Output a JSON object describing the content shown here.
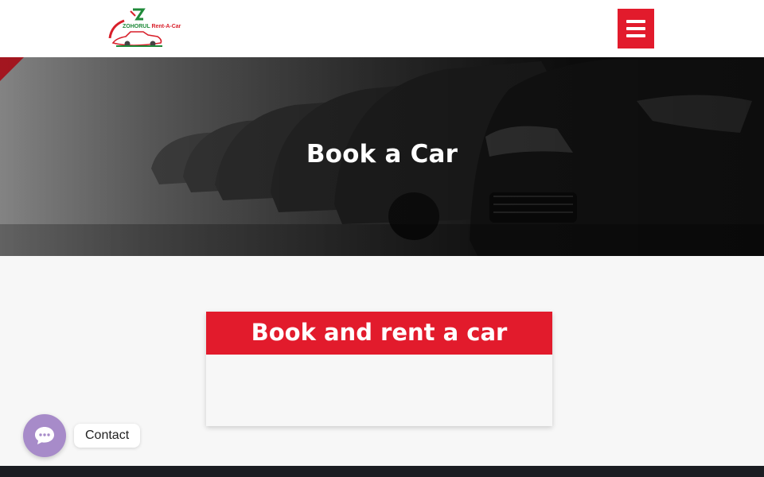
{
  "header": {
    "logo": {
      "text_main": "ZOHORUL",
      "text_accent": "Rent-A-Car"
    },
    "menu_icon": "hamburger-icon",
    "accent_color": "#e21b2c"
  },
  "hero": {
    "title": "Book a Car"
  },
  "booking_card": {
    "title": "Book and rent a car"
  },
  "contact_widget": {
    "label": "Contact",
    "icon": "chat-bubble-icon",
    "color": "#a78bc9"
  }
}
